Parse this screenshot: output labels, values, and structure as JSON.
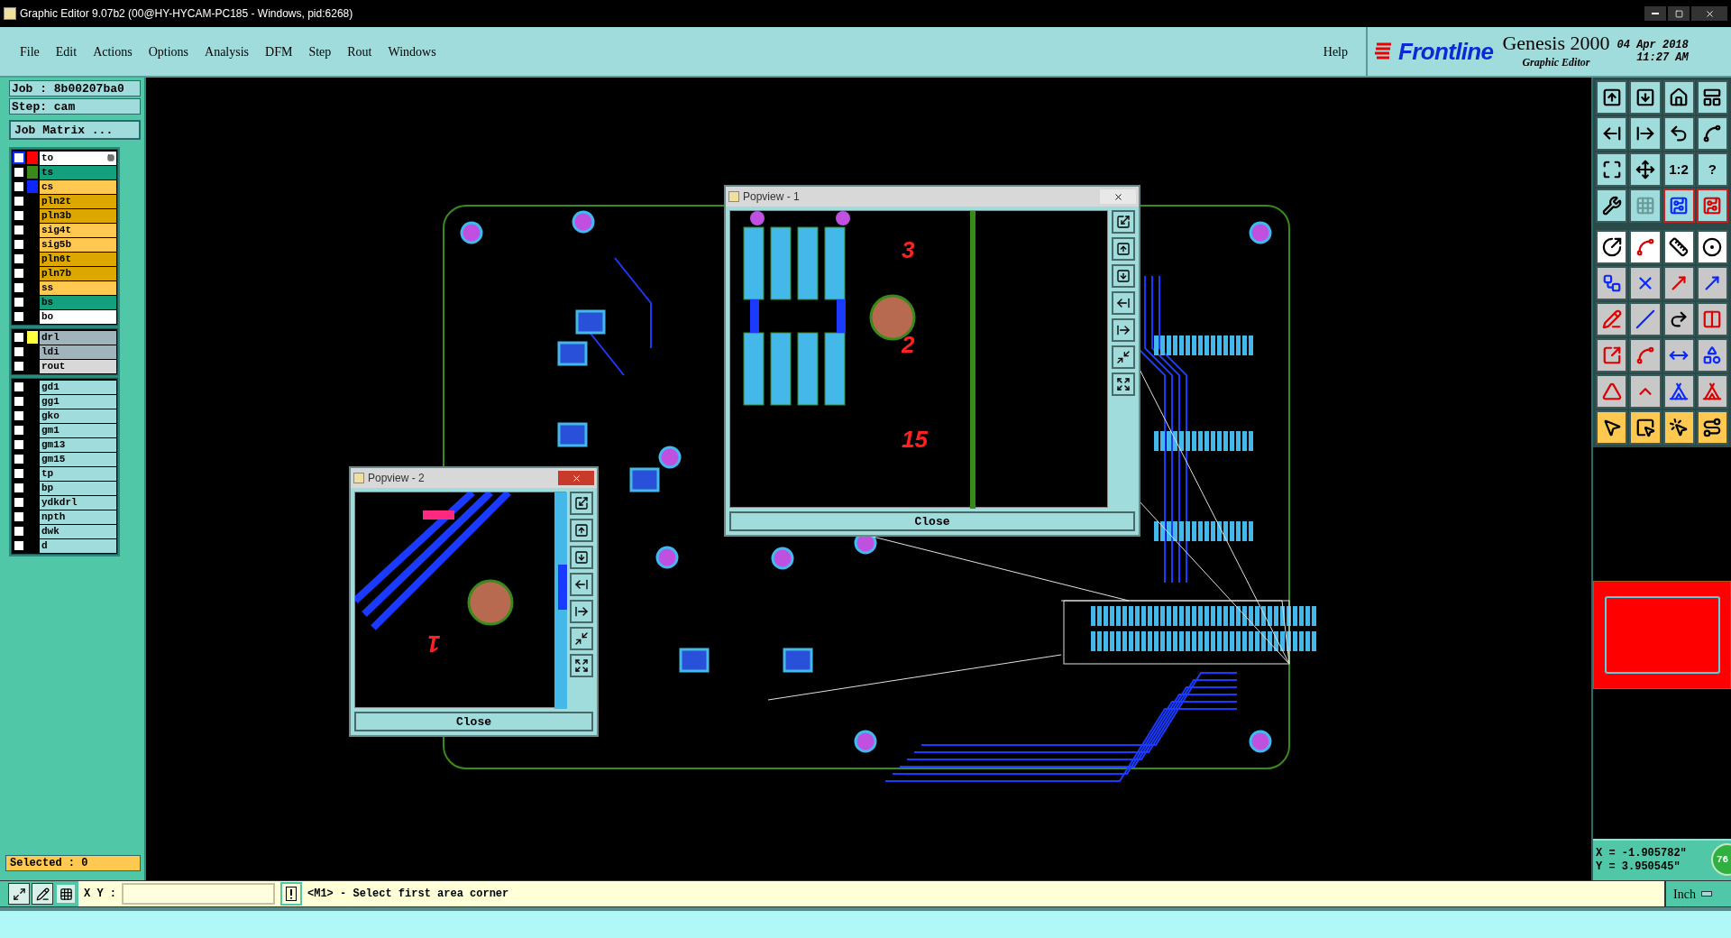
{
  "window": {
    "title": "Graphic Editor 9.07b2 (00@HY-HYCAM-PC185 - Windows, pid:6268)"
  },
  "menu": [
    "File",
    "Edit",
    "Actions",
    "Options",
    "Analysis",
    "DFM",
    "Step",
    "Rout",
    "Windows"
  ],
  "help": "Help",
  "brand": {
    "logo": "Frontline",
    "product": "Genesis 2000",
    "subtitle": "Graphic Editor",
    "date": "04 Apr 2018",
    "time": "11:27 AM"
  },
  "job": "Job : 8b00207ba0",
  "step": "Step: cam",
  "job_matrix": "Job Matrix ...",
  "layer_groups": [
    [
      {
        "name": "to",
        "kind": "silk",
        "color": "#ff0000",
        "checked": false,
        "work": true
      },
      {
        "name": "ts",
        "kind": "mask",
        "color": "#3a8a1a",
        "checked": false,
        "work": false
      },
      {
        "name": "cs",
        "kind": "signal",
        "color": "#0a28ff",
        "checked": false,
        "work": false
      },
      {
        "name": "pln2t",
        "kind": "power",
        "checked": false,
        "work": false
      },
      {
        "name": "pln3b",
        "kind": "power",
        "checked": false,
        "work": false
      },
      {
        "name": "sig4t",
        "kind": "signal",
        "checked": false,
        "work": false
      },
      {
        "name": "sig5b",
        "kind": "signal",
        "checked": false,
        "work": false
      },
      {
        "name": "pln6t",
        "kind": "power",
        "checked": false,
        "work": false
      },
      {
        "name": "pln7b",
        "kind": "power",
        "checked": false,
        "work": false
      },
      {
        "name": "ss",
        "kind": "signal",
        "checked": false,
        "work": false
      },
      {
        "name": "bs",
        "kind": "mask",
        "checked": false,
        "work": false
      },
      {
        "name": "bo",
        "kind": "silk",
        "checked": false,
        "work": false
      }
    ],
    [
      {
        "name": "drl",
        "kind": "drill",
        "color": "#ffff40",
        "checked": false,
        "work": false
      },
      {
        "name": "ldi",
        "kind": "drill",
        "checked": false,
        "work": false
      },
      {
        "name": "rout",
        "kind": "rout",
        "checked": false,
        "work": false
      }
    ],
    [
      {
        "name": "gd1",
        "kind": "document",
        "checked": false,
        "work": false
      },
      {
        "name": "gg1",
        "kind": "document",
        "checked": false,
        "work": false
      },
      {
        "name": "gko",
        "kind": "document",
        "checked": false,
        "work": false
      },
      {
        "name": "gm1",
        "kind": "document",
        "checked": false,
        "work": false
      },
      {
        "name": "gm13",
        "kind": "document",
        "checked": false,
        "work": false
      },
      {
        "name": "gm15",
        "kind": "document",
        "checked": false,
        "work": false
      },
      {
        "name": "tp",
        "kind": "document",
        "checked": false,
        "work": false
      },
      {
        "name": "bp",
        "kind": "document",
        "checked": false,
        "work": false
      },
      {
        "name": "ydkdrl",
        "kind": "document",
        "checked": false,
        "work": false
      },
      {
        "name": "npth",
        "kind": "document",
        "checked": false,
        "work": false
      },
      {
        "name": "dwk",
        "kind": "document",
        "checked": false,
        "work": false
      },
      {
        "name": "d",
        "kind": "document",
        "checked": false,
        "work": false
      }
    ]
  ],
  "selected_count": "Selected : 0",
  "popviews": [
    {
      "title": "Popview - 1",
      "close": "Close",
      "labels": [
        "3",
        "2",
        "15"
      ]
    },
    {
      "title": "Popview - 2",
      "close": "Close",
      "labels": [
        "1"
      ]
    }
  ],
  "tools": [
    {
      "kind": "view",
      "selected": false
    },
    {
      "kind": "view",
      "selected": false
    },
    {
      "kind": "view",
      "selected": false
    },
    {
      "kind": "view",
      "selected": false
    },
    {
      "kind": "view",
      "selected": false
    },
    {
      "kind": "view",
      "selected": false
    },
    {
      "kind": "view",
      "selected": false
    },
    {
      "kind": "view",
      "selected": false
    },
    {
      "kind": "view",
      "selected": false
    },
    {
      "kind": "view",
      "selected": false
    },
    {
      "kind": "view",
      "selected": false,
      "label": "1:2"
    },
    {
      "kind": "view",
      "selected": false,
      "label": "?"
    },
    {
      "kind": "view",
      "selected": false
    },
    {
      "kind": "view",
      "selected": false
    },
    {
      "kind": "view",
      "selected": true
    },
    {
      "kind": "view",
      "selected": true
    },
    {
      "kind": "display",
      "selected": false
    },
    {
      "kind": "display",
      "selected": false
    },
    {
      "kind": "display",
      "selected": false
    },
    {
      "kind": "display",
      "selected": false
    },
    {
      "kind": "edit",
      "selected": false
    },
    {
      "kind": "edit",
      "selected": false
    },
    {
      "kind": "edit",
      "selected": false
    },
    {
      "kind": "edit",
      "selected": false
    },
    {
      "kind": "edit",
      "selected": false
    },
    {
      "kind": "edit",
      "selected": false
    },
    {
      "kind": "edit",
      "selected": false
    },
    {
      "kind": "edit",
      "selected": false
    },
    {
      "kind": "edit",
      "selected": false
    },
    {
      "kind": "edit",
      "selected": false
    },
    {
      "kind": "edit",
      "selected": false
    },
    {
      "kind": "edit",
      "selected": false
    },
    {
      "kind": "edit",
      "selected": false
    },
    {
      "kind": "edit",
      "selected": false
    },
    {
      "kind": "edit",
      "selected": false
    },
    {
      "kind": "edit",
      "selected": false
    },
    {
      "kind": "select",
      "selected": false
    },
    {
      "kind": "select",
      "selected": false
    },
    {
      "kind": "select",
      "selected": false
    },
    {
      "kind": "select",
      "selected": false
    }
  ],
  "coordinates": {
    "x": "X = -1.905782\"",
    "y": "Y = 3.950545\""
  },
  "badge": "76",
  "command": {
    "label": "X Y :",
    "message": "<M1> - Select first area corner",
    "units": "Inch"
  }
}
